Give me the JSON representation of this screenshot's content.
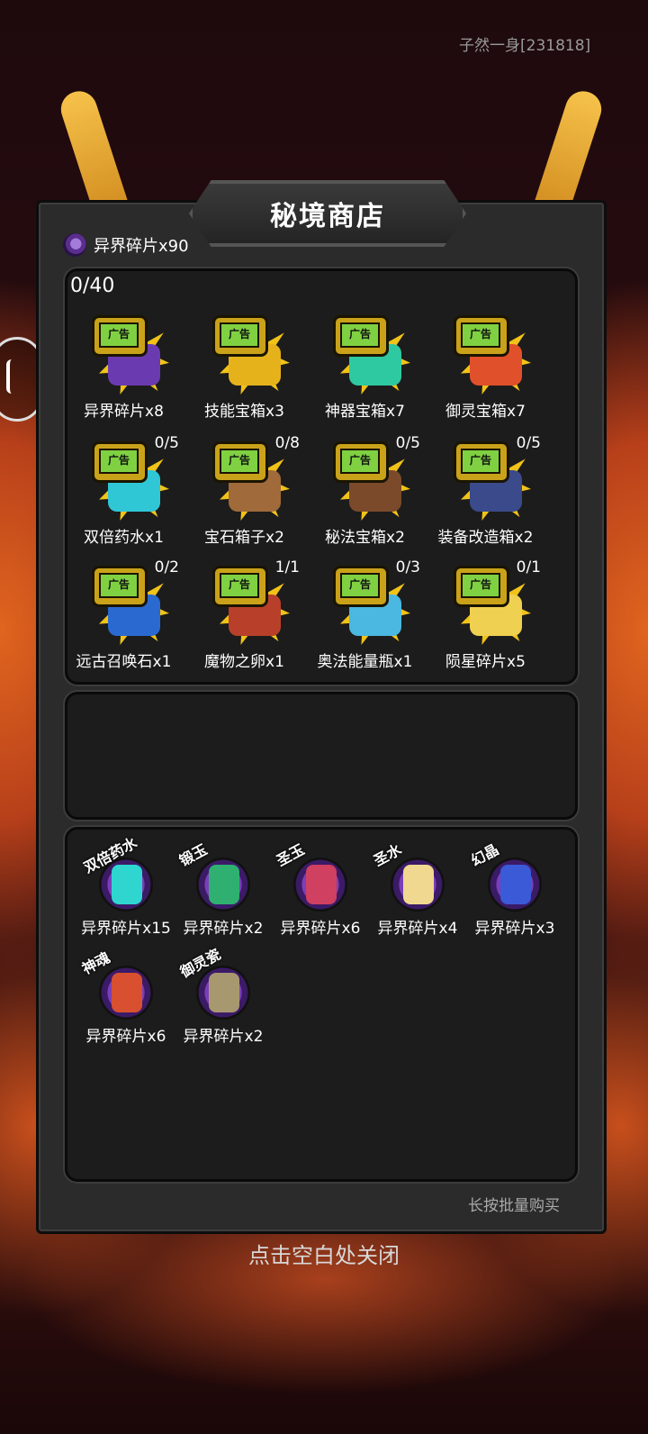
{
  "header": {
    "user": "子然一身[231818]"
  },
  "shop": {
    "title": "秘境商店",
    "currency": {
      "icon": "purple-fragment-icon",
      "label": "异界碎片x90"
    },
    "ad_counter": "0/40",
    "ad_badge": "广告",
    "ad_items": [
      {
        "name": "异界碎片x8",
        "count": "",
        "icon": "purple-fragment-icon",
        "color": "#6a3bb0"
      },
      {
        "name": "技能宝箱x3",
        "count": "",
        "icon": "gold-chest-icon",
        "color": "#e6b21c"
      },
      {
        "name": "神器宝箱x7",
        "count": "",
        "icon": "teal-chest-icon",
        "color": "#2ec9a0"
      },
      {
        "name": "御灵宝箱x7",
        "count": "",
        "icon": "red-chest-icon",
        "color": "#e0502a"
      },
      {
        "name": "双倍药水x1",
        "count": "0/5",
        "icon": "potion-icon",
        "color": "#2fc6d6"
      },
      {
        "name": "宝石箱子x2",
        "count": "0/8",
        "icon": "gem-bag-icon",
        "color": "#a06a3a"
      },
      {
        "name": "秘法宝箱x2",
        "count": "0/5",
        "icon": "arcane-chest-icon",
        "color": "#7a4a2a"
      },
      {
        "name": "装备改造箱x2",
        "count": "0/5",
        "icon": "equipment-chest-icon",
        "color": "#3a4a8a"
      },
      {
        "name": "远古召唤石x1",
        "count": "0/2",
        "icon": "summon-stone-icon",
        "color": "#2a6ad0"
      },
      {
        "name": "魔物之卵x1",
        "count": "1/1",
        "icon": "monster-egg-icon",
        "color": "#b8402a"
      },
      {
        "name": "奥法能量瓶x1",
        "count": "0/3",
        "icon": "mana-bottle-icon",
        "color": "#4ab8e0"
      },
      {
        "name": "陨星碎片x5",
        "count": "0/1",
        "icon": "meteor-shard-icon",
        "color": "#f0d050"
      }
    ],
    "shop_items": [
      {
        "tag": "双倍药水",
        "price": "异界碎片x15",
        "icon": "hourglass-potion-icon",
        "color": "#2fd6d0"
      },
      {
        "tag": "锻玉",
        "price": "异界碎片x2",
        "icon": "green-jade-icon",
        "color": "#2fb070"
      },
      {
        "tag": "圣玉",
        "price": "异界碎片x6",
        "icon": "red-crystal-icon",
        "color": "#d04060"
      },
      {
        "tag": "圣水",
        "price": "异界碎片x4",
        "icon": "holy-water-icon",
        "color": "#f0d890"
      },
      {
        "tag": "幻晶",
        "price": "异界碎片x3",
        "icon": "blue-crystal-icon",
        "color": "#3a5ad8"
      },
      {
        "tag": "神魂",
        "price": "异界碎片x6",
        "icon": "spirit-flame-icon",
        "color": "#d85030"
      },
      {
        "tag": "御灵瓷",
        "price": "异界碎片x2",
        "icon": "spirit-vase-icon",
        "color": "#a89870"
      }
    ],
    "hold_hint": "长按批量购买"
  },
  "close_hint": "点击空白处关闭"
}
